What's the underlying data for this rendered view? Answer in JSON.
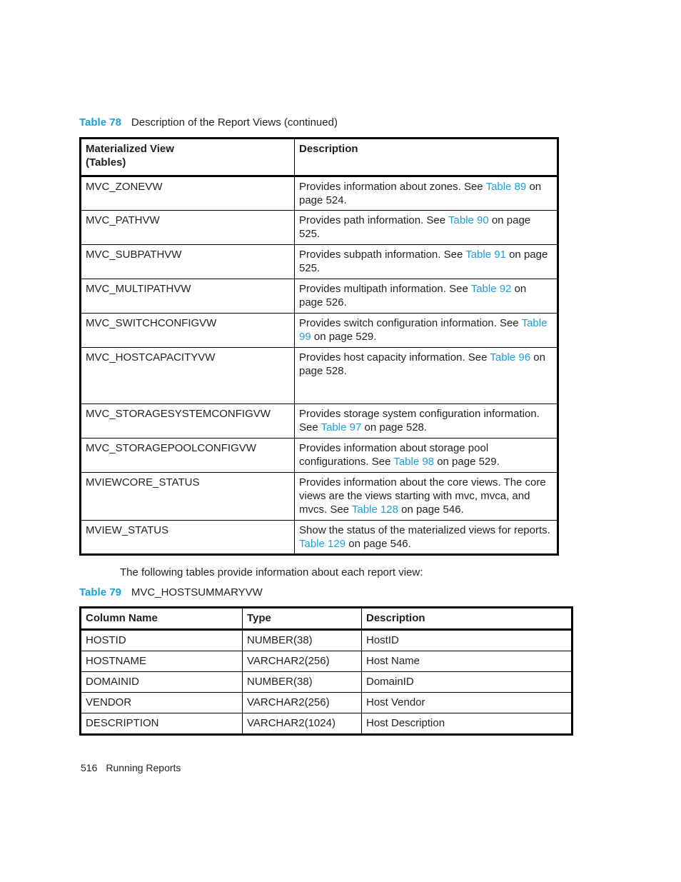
{
  "table78": {
    "label": "Table 78",
    "title": "Description of the Report Views (continued)",
    "headers": {
      "col1_line1": "Materialized View",
      "col1_line2": "(Tables)",
      "col2": "Description"
    },
    "rows": [
      {
        "view": "MVC_ZONEVW",
        "pre": "Provides information about zones. See ",
        "link": "Table 89",
        "post": " on page 524."
      },
      {
        "view": "MVC_PATHVW",
        "pre": "Provides path information. See ",
        "link": "Table 90",
        "post": " on page 525."
      },
      {
        "view": "MVC_SUBPATHVW",
        "pre": "Provides subpath information. See ",
        "link": "Table 91",
        "post": " on page 525."
      },
      {
        "view": "MVC_MULTIPATHVW",
        "pre": "Provides multipath information. See ",
        "link": "Table 92",
        "post": " on page 526."
      },
      {
        "view": "MVC_SWITCHCONFIGVW",
        "pre": "Provides switch configuration information. See ",
        "link": "Table 99",
        "post": " on page 529."
      },
      {
        "view": "MVC_HOSTCAPACITYVW",
        "pre": "Provides host capacity information. See ",
        "link": "Table 96",
        "post": " on page 528."
      },
      {
        "view": "MVC_STORAGESYSTEMCONFIGVW",
        "pre": "Provides storage system configuration information. See ",
        "link": "Table 97",
        "post": " on page 528."
      },
      {
        "view": "MVC_STORAGEPOOLCONFIGVW",
        "pre": "Provides information about storage pool configurations. See ",
        "link": "Table 98",
        "post": " on page 529."
      },
      {
        "view": "MVIEWCORE_STATUS",
        "pre": "Provides information about the core views. The core views are the views starting with mvc, mvca, and mvcs. See ",
        "link": "Table 128",
        "post": " on page 546."
      },
      {
        "view": "MVIEW_STATUS",
        "pre": "Show the status of the materialized views for reports. ",
        "link": "Table 129",
        "post": " on page 546."
      }
    ]
  },
  "intro_text": "The following tables provide information about each report view:",
  "table79": {
    "label": "Table 79",
    "title": "MVC_HOSTSUMMARYVW",
    "headers": [
      "Column Name",
      "Type",
      "Description"
    ],
    "rows": [
      [
        "HOSTID",
        "NUMBER(38)",
        "HostID"
      ],
      [
        "HOSTNAME",
        "VARCHAR2(256)",
        "Host Name"
      ],
      [
        "DOMAINID",
        "NUMBER(38)",
        "DomainID"
      ],
      [
        "VENDOR",
        "VARCHAR2(256)",
        "Host Vendor"
      ],
      [
        "DESCRIPTION",
        "VARCHAR2(1024)",
        "Host Description"
      ]
    ]
  },
  "footer": {
    "page_number": "516",
    "section": "Running Reports"
  },
  "colors": {
    "link": "#1a9fd9",
    "text": "#231f20"
  }
}
